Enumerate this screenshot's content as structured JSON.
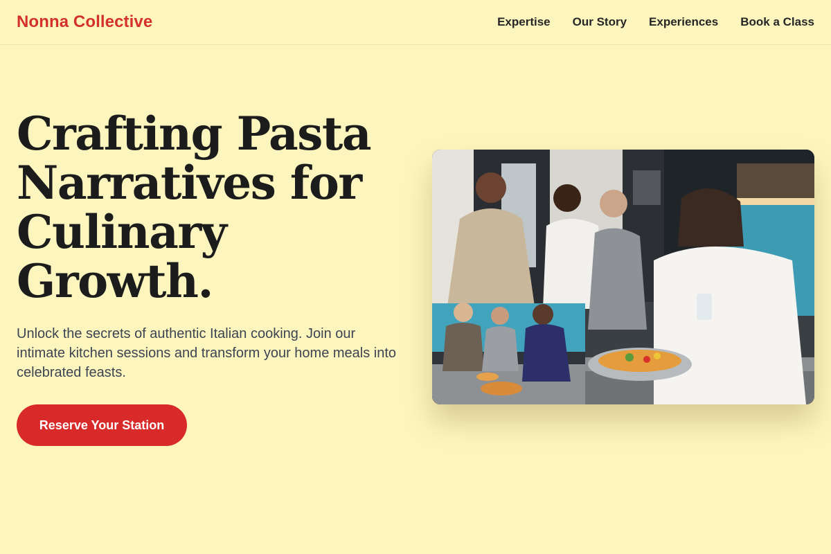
{
  "header": {
    "brand": "Nonna Collective",
    "nav": [
      {
        "label": "Expertise"
      },
      {
        "label": "Our Story"
      },
      {
        "label": "Experiences"
      },
      {
        "label": "Book a Class"
      }
    ]
  },
  "hero": {
    "title": "Crafting Pasta Narratives for Culinary Growth.",
    "subtitle": "Unlock the secrets of authentic Italian cooking. Join our intimate kitchen sessions and transform your home meals into celebrated feasts.",
    "cta_label": "Reserve Your Station",
    "image_alt": "People cooking together in a kitchen"
  },
  "colors": {
    "background": "#fdf5be",
    "brand": "#d4312c",
    "cta": "#d92a2a",
    "heading": "#1c1c1c",
    "body_text": "#3c4452"
  }
}
